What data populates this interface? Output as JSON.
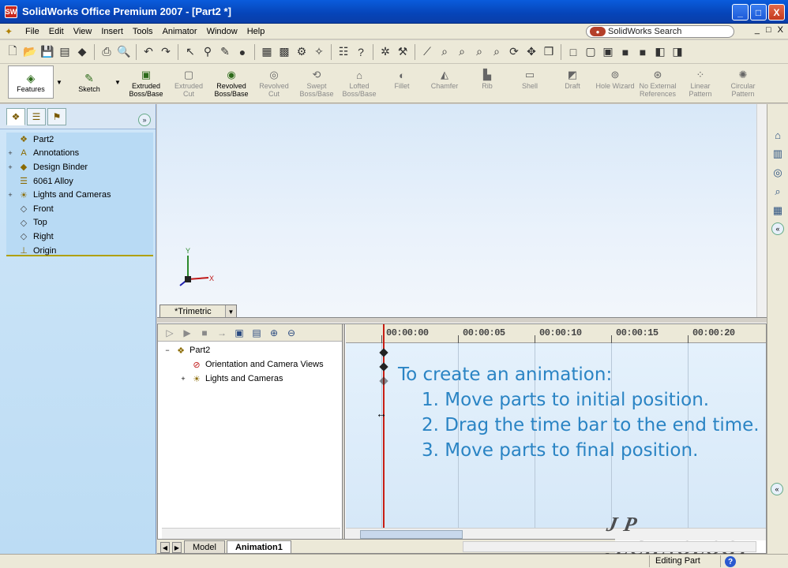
{
  "window": {
    "title": "SolidWorks Office Premium 2007 - [Part2 *]",
    "app_icon": "SW",
    "minimize_label": "_",
    "maximize_label": "□",
    "close_label": "X"
  },
  "menubar": {
    "items": [
      "File",
      "Edit",
      "View",
      "Insert",
      "Tools",
      "Animator",
      "Window",
      "Help"
    ],
    "search_label": "SolidWorks Search",
    "mdi_buttons": [
      "_",
      "□",
      "X"
    ]
  },
  "command_manager": {
    "tabs": [
      {
        "label": "Features",
        "icon": "features-icon"
      },
      {
        "label": "Sketch",
        "icon": "sketch-icon"
      }
    ],
    "tools": [
      {
        "label": "Extruded\nBoss/Base",
        "enabled": true,
        "icon": "extrude-boss-icon"
      },
      {
        "label": "Extruded\nCut",
        "enabled": false,
        "icon": "extrude-cut-icon"
      },
      {
        "label": "Revolved\nBoss/Base",
        "enabled": true,
        "icon": "revolve-boss-icon"
      },
      {
        "label": "Revolved\nCut",
        "enabled": false,
        "icon": "revolve-cut-icon"
      },
      {
        "label": "Swept\nBoss/Base",
        "enabled": false,
        "icon": "sweep-icon"
      },
      {
        "label": "Lofted\nBoss/Base",
        "enabled": false,
        "icon": "loft-icon"
      },
      {
        "label": "Fillet",
        "enabled": false,
        "icon": "fillet-icon"
      },
      {
        "label": "Chamfer",
        "enabled": false,
        "icon": "chamfer-icon"
      },
      {
        "label": "Rib",
        "enabled": false,
        "icon": "rib-icon"
      },
      {
        "label": "Shell",
        "enabled": false,
        "icon": "shell-icon"
      },
      {
        "label": "Draft",
        "enabled": false,
        "icon": "draft-icon"
      },
      {
        "label": "Hole Wizard",
        "enabled": false,
        "icon": "hole-wizard-icon"
      },
      {
        "label": "No External\nReferences",
        "enabled": false,
        "icon": "no-ext-ref-icon"
      },
      {
        "label": "Linear\nPattern",
        "enabled": false,
        "icon": "linear-pattern-icon"
      },
      {
        "label": "Circular\nPattern",
        "enabled": false,
        "icon": "circular-pattern-icon"
      }
    ]
  },
  "feature_tree": {
    "items": [
      {
        "label": "Part2",
        "icon": "part-icon",
        "expander": ""
      },
      {
        "label": "Annotations",
        "icon": "annotations-icon",
        "expander": "+"
      },
      {
        "label": "Design Binder",
        "icon": "design-binder-icon",
        "expander": "+"
      },
      {
        "label": "6061 Alloy",
        "icon": "material-icon",
        "expander": ""
      },
      {
        "label": "Lights and Cameras",
        "icon": "lights-icon",
        "expander": "+"
      },
      {
        "label": "Front",
        "icon": "plane-icon",
        "expander": ""
      },
      {
        "label": "Top",
        "icon": "plane-icon",
        "expander": ""
      },
      {
        "label": "Right",
        "icon": "plane-icon",
        "expander": ""
      },
      {
        "label": "Origin",
        "icon": "origin-icon",
        "expander": ""
      }
    ]
  },
  "viewport": {
    "view_orientation": "*Trimetric",
    "triad_labels": {
      "x": "X",
      "y": "Y"
    }
  },
  "motion_manager": {
    "tree": [
      {
        "label": "Part2",
        "icon": "part-icon",
        "expander": "−",
        "indent": 0
      },
      {
        "label": "Orientation and Camera Views",
        "icon": "camera-views-icon",
        "expander": "",
        "indent": 1
      },
      {
        "label": "Lights and Cameras",
        "icon": "lights-icon",
        "expander": "+",
        "indent": 1
      }
    ],
    "time_labels": [
      "00:00:00",
      "00:00:05",
      "00:00:10",
      "00:00:15",
      "00:00:20"
    ],
    "instructions": {
      "heading": "To create an animation:",
      "steps": [
        "1. Move parts to initial position.",
        "2. Drag the time bar to the end time.",
        "3. Move parts to final position."
      ]
    },
    "watermark": "J P TECHNOLOGY"
  },
  "bottom_tabs": {
    "tabs": [
      "Model",
      "Animation1"
    ],
    "active": "Animation1"
  },
  "statusbar": {
    "status": "Editing Part",
    "help": "?"
  },
  "colors": {
    "title_bar": "#0644b8",
    "tree_bg": "#b8daf4",
    "timebar": "#c81e14",
    "instruction_text": "#2a84c4"
  }
}
